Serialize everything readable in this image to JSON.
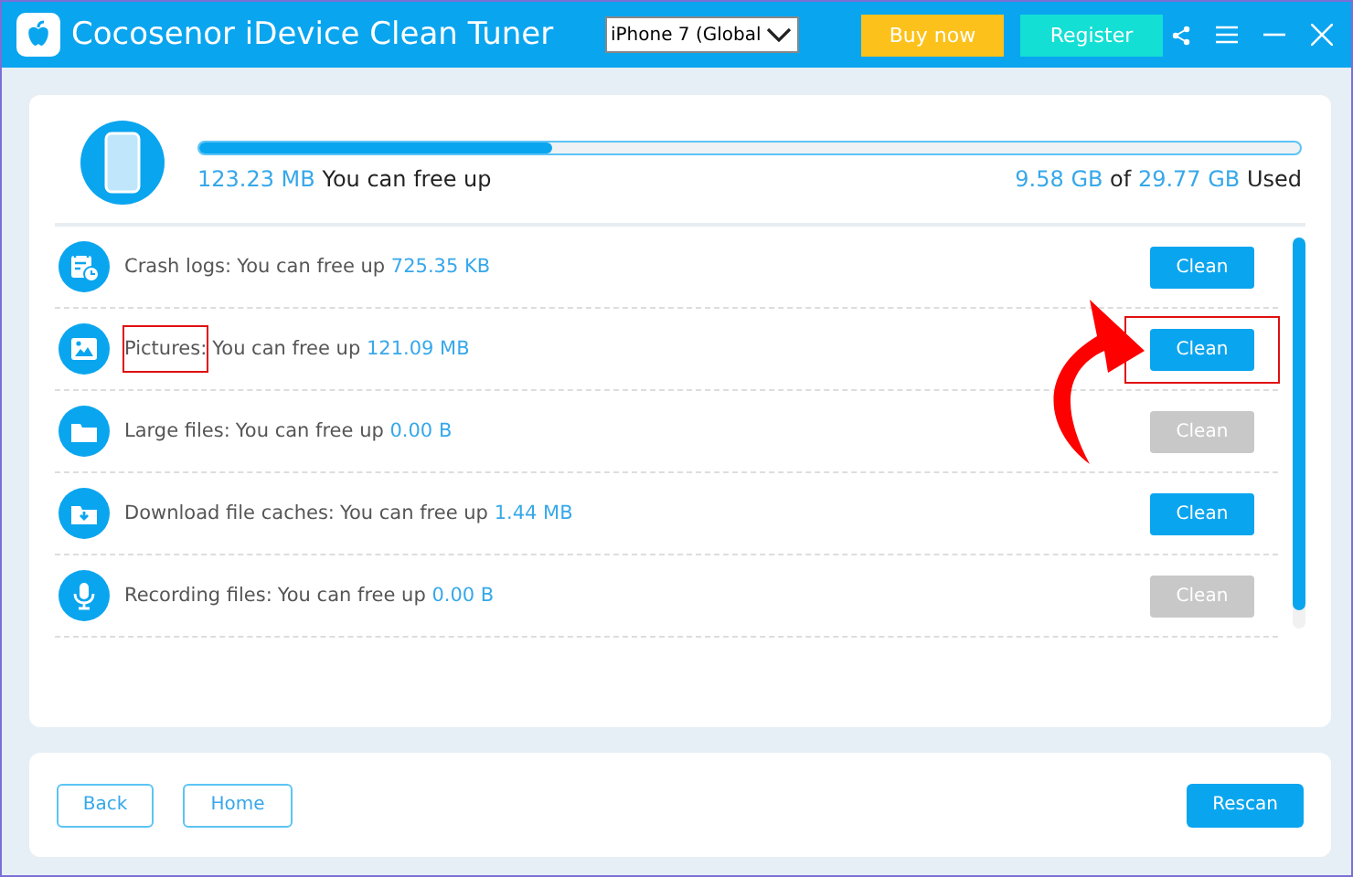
{
  "window": {
    "title": "Cocosenor iDevice Clean Tuner",
    "device": "iPhone 7 (Global",
    "buttons": [
      {
        "label": "Buy now",
        "kind": "buy"
      },
      {
        "label": "Register",
        "kind": "register"
      }
    ]
  },
  "summary": {
    "level": 0.32,
    "amount": "123.23 MB",
    "text": "You can free up",
    "used": "9.58 GB",
    "of": "of",
    "total": "29.77 GB",
    "used_label": "Used"
  },
  "items": [
    {
      "kind": "crash",
      "label": "Crash logs:",
      "text": "You can free up",
      "amount": "725.35 KB",
      "button": "Clean",
      "disabled": false,
      "highlighted": false
    },
    {
      "kind": "pictures",
      "label": "Pictures:",
      "text": "You can free up",
      "amount": "121.09 MB",
      "button": "Clean",
      "disabled": false,
      "highlighted": true
    },
    {
      "kind": "large",
      "label": "Large files:",
      "text": "You can free up",
      "amount": "0.00 B",
      "button": "Clean",
      "disabled": true,
      "highlighted": false
    },
    {
      "kind": "download",
      "label": "Download file caches:",
      "text": "You can free up",
      "amount": "1.44 MB",
      "button": "Clean",
      "disabled": false,
      "highlighted": false
    },
    {
      "kind": "recording",
      "label": "Recording files:",
      "text": "You can free up",
      "amount": "0.00 B",
      "button": "Clean",
      "disabled": true,
      "highlighted": false
    }
  ],
  "footer": {
    "buttons": [
      {
        "label": "Back",
        "kind": "outline"
      },
      {
        "label": "Home",
        "kind": "outline"
      },
      {
        "label": "Rescan",
        "kind": "primary"
      }
    ]
  }
}
